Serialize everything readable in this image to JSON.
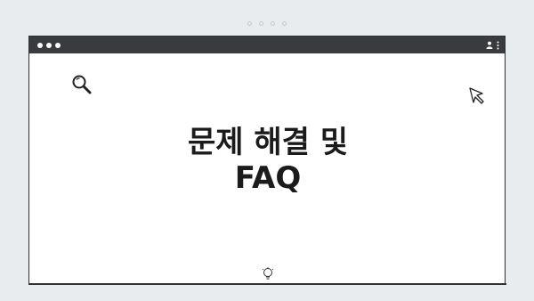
{
  "carousel": {
    "dot_count": 4
  },
  "window": {
    "traffic_lights": [
      "close",
      "minimize",
      "maximize"
    ],
    "titlebar_icons": [
      "user-icon",
      "kebab-menu-icon"
    ]
  },
  "content": {
    "headline_line1": "문제 해결 및",
    "headline_line2": "FAQ",
    "icons": [
      "search-icon",
      "cursor-icon",
      "lightbulb-icon"
    ]
  },
  "colors": {
    "background": "#e9ecef",
    "titlebar": "#3a3b3f",
    "window": "#ffffff",
    "text": "#1b1b1b"
  }
}
